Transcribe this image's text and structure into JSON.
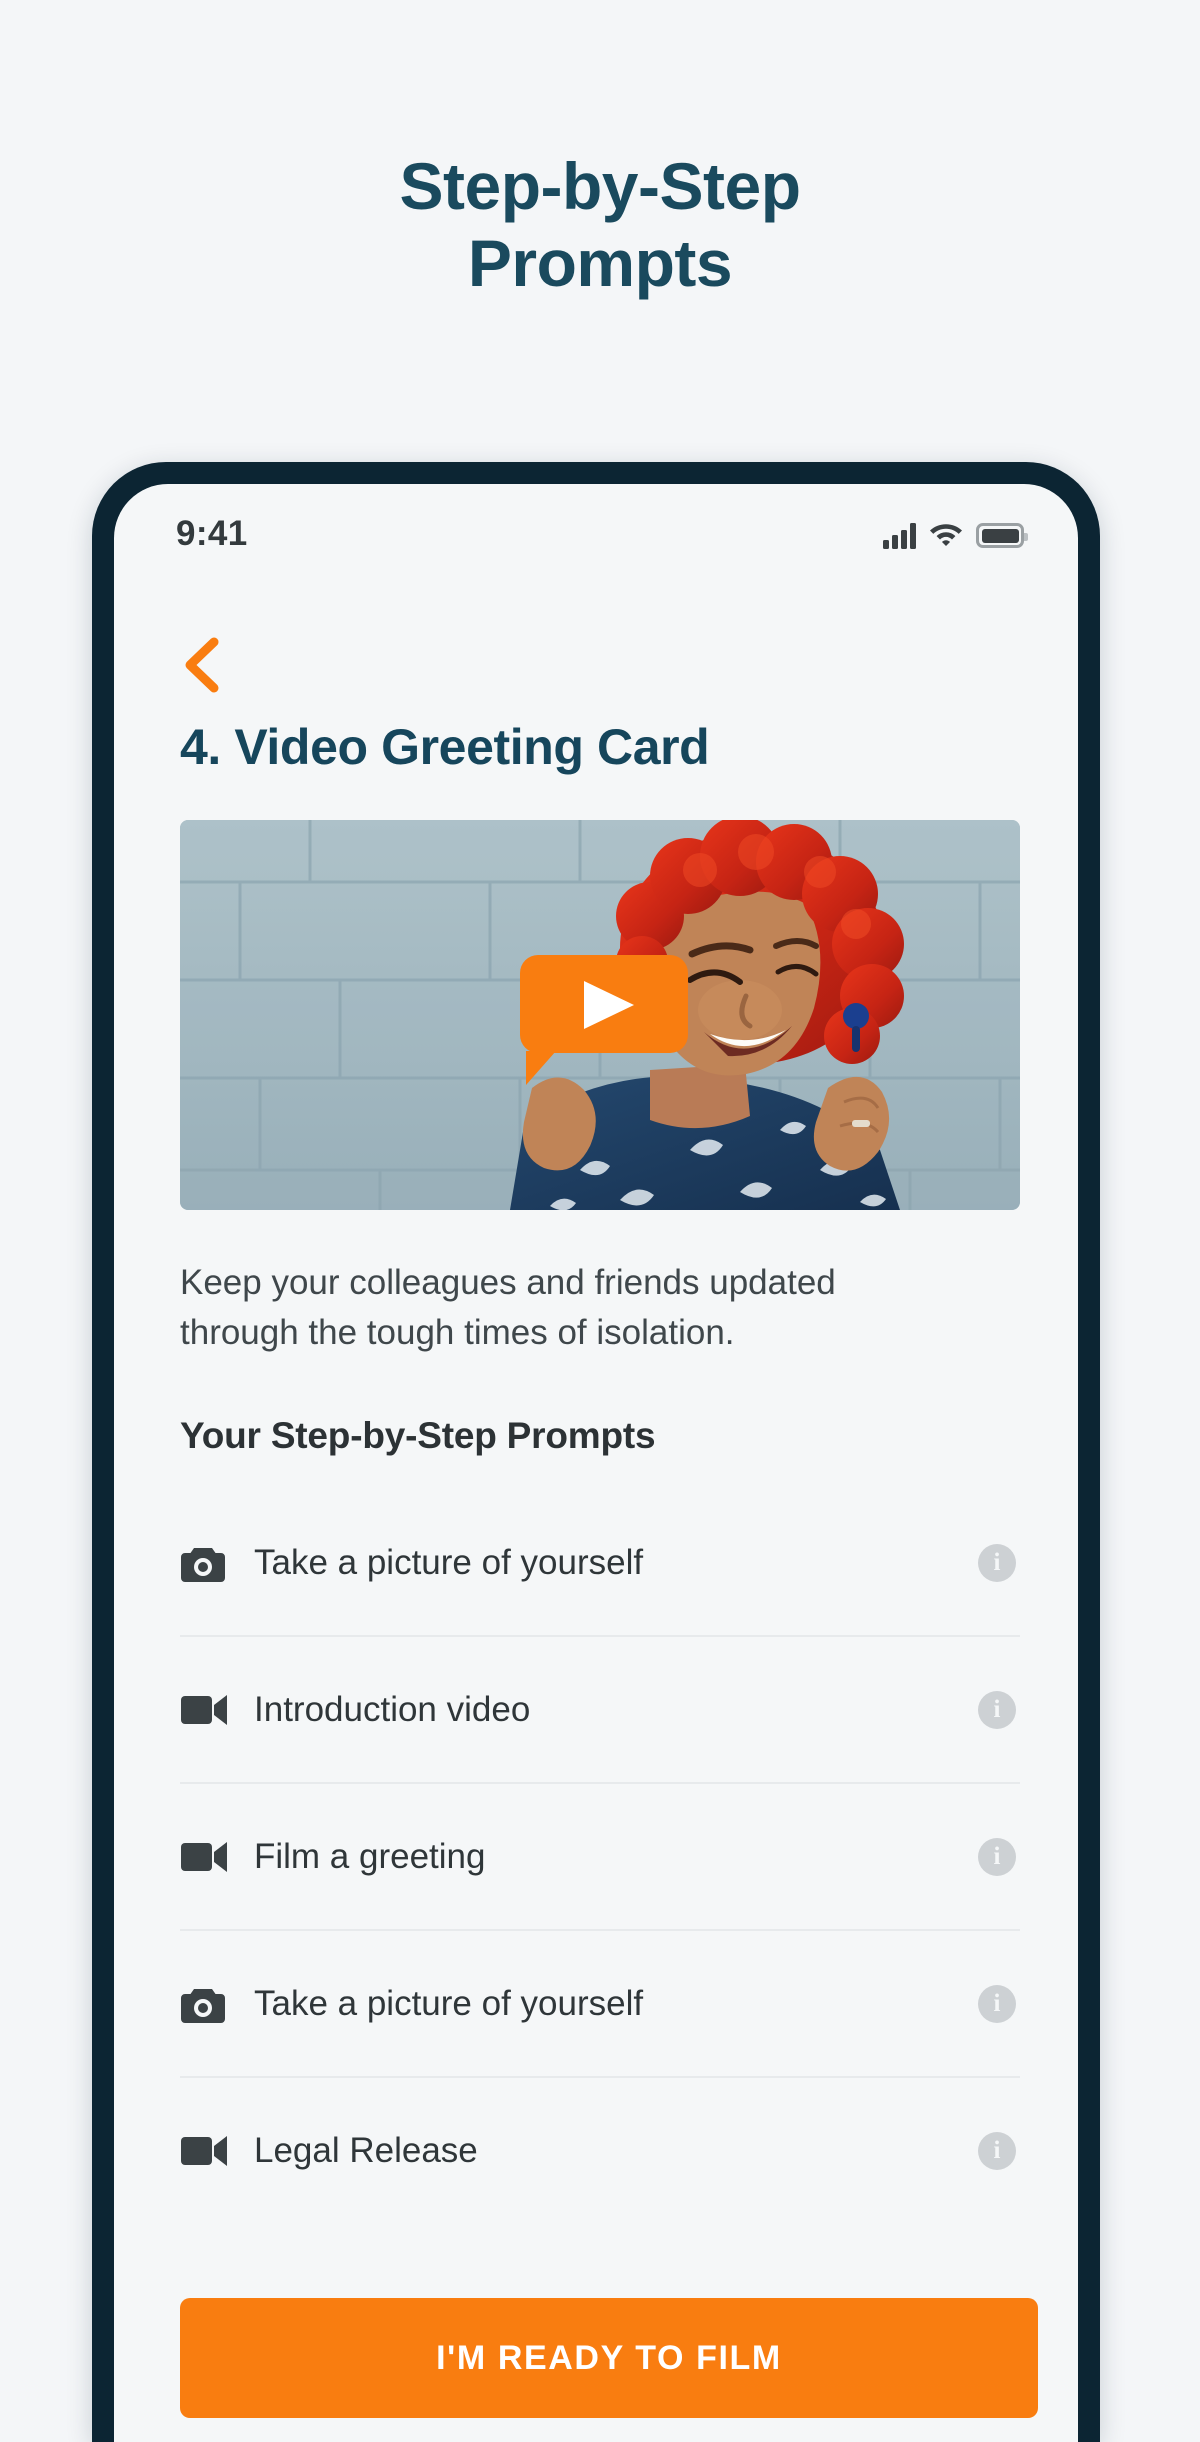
{
  "page": {
    "heading_line1": "Step-by-Step",
    "heading_line2": "Prompts",
    "background_color": "#f4f6f8",
    "heading_color": "#1a4a5e"
  },
  "phone": {
    "frame_color": "#0c2533",
    "screen_background": "#f5f7f8"
  },
  "status_bar": {
    "time": "9:41",
    "signal_icon": "cellular-signal-icon",
    "wifi_icon": "wifi-icon",
    "battery_icon": "battery-full-icon"
  },
  "nav": {
    "back_icon": "chevron-left-icon",
    "back_color": "#f97d10"
  },
  "screen": {
    "title": "4. Video Greeting Card",
    "title_color": "#16465c",
    "description": "Keep your colleagues and friends updated through the tough times of isolation."
  },
  "video": {
    "play_icon": "play-button-icon",
    "play_button_color": "#f97d10",
    "alt": "Woman with red curly hair smiling against a blue-gray brick wall"
  },
  "prompts": {
    "heading": "Your Step-by-Step Prompts",
    "items": [
      {
        "icon": "camera-icon",
        "label": "Take a picture of yourself",
        "info": "i"
      },
      {
        "icon": "video-camera-icon",
        "label": "Introduction video",
        "info": "i"
      },
      {
        "icon": "video-camera-icon",
        "label": "Film a greeting",
        "info": "i"
      },
      {
        "icon": "camera-icon",
        "label": "Take a picture of yourself",
        "info": "i"
      },
      {
        "icon": "video-camera-icon",
        "label": "Legal Release",
        "info": "i"
      }
    ]
  },
  "cta": {
    "label": "I'M READY TO FILM",
    "color": "#f97d10"
  }
}
